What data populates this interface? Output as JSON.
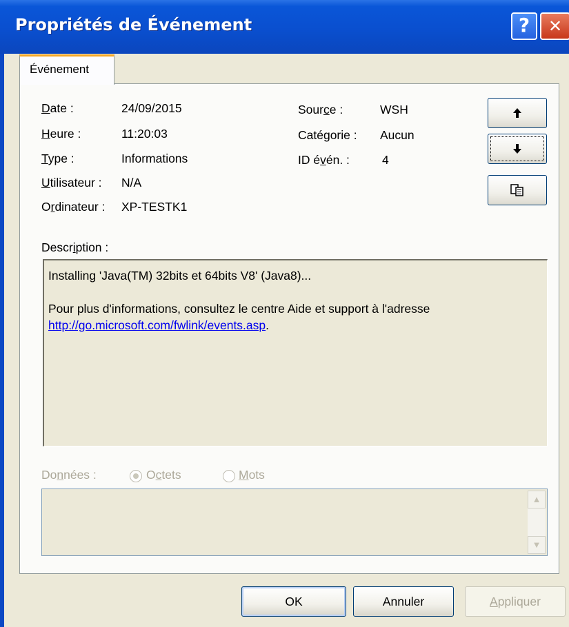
{
  "window": {
    "title": "Propriétés de Événement",
    "help_glyph": "?",
    "close_glyph": "✕"
  },
  "tabs": [
    {
      "label": "Événement",
      "active": true
    }
  ],
  "event": {
    "date_label": "Date :",
    "date_value": "24/09/2015",
    "time_label": "Heure :",
    "time_value": "11:20:03",
    "type_label": "Type :",
    "type_value": "Informations",
    "user_label": "Utilisateur :",
    "user_value": "N/A",
    "computer_label": "Ordinateur :",
    "computer_value": "XP-TESTK1",
    "source_label": "Source :",
    "source_value": "WSH",
    "category_label": "Catégorie :",
    "category_value": "Aucun",
    "id_label": "ID évén. :",
    "id_value": "4"
  },
  "side_buttons": [
    {
      "icon": "arrow-up-icon",
      "glyph": "🠕"
    },
    {
      "icon": "arrow-down-icon",
      "glyph": "🠗"
    },
    {
      "icon": "copy-icon"
    }
  ],
  "description": {
    "label": "Description :",
    "line1": "Installing 'Java(TM) 32bits et 64bits V8' (Java8)...",
    "line2": "Pour plus d'informations, consultez le centre Aide et support à l'adresse",
    "link": "http://go.microsoft.com/fwlink/events.asp",
    "link_suffix": "."
  },
  "data": {
    "label": "Données :",
    "radio_bytes": "Octets",
    "radio_words": "Mots",
    "selected": "Octets"
  },
  "buttons": {
    "ok": "OK",
    "cancel": "Annuler",
    "apply": "Appliquer"
  },
  "colors": {
    "titlebar": "#0a4fcf",
    "link": "#0000ee",
    "disabled_text": "#aca899"
  }
}
